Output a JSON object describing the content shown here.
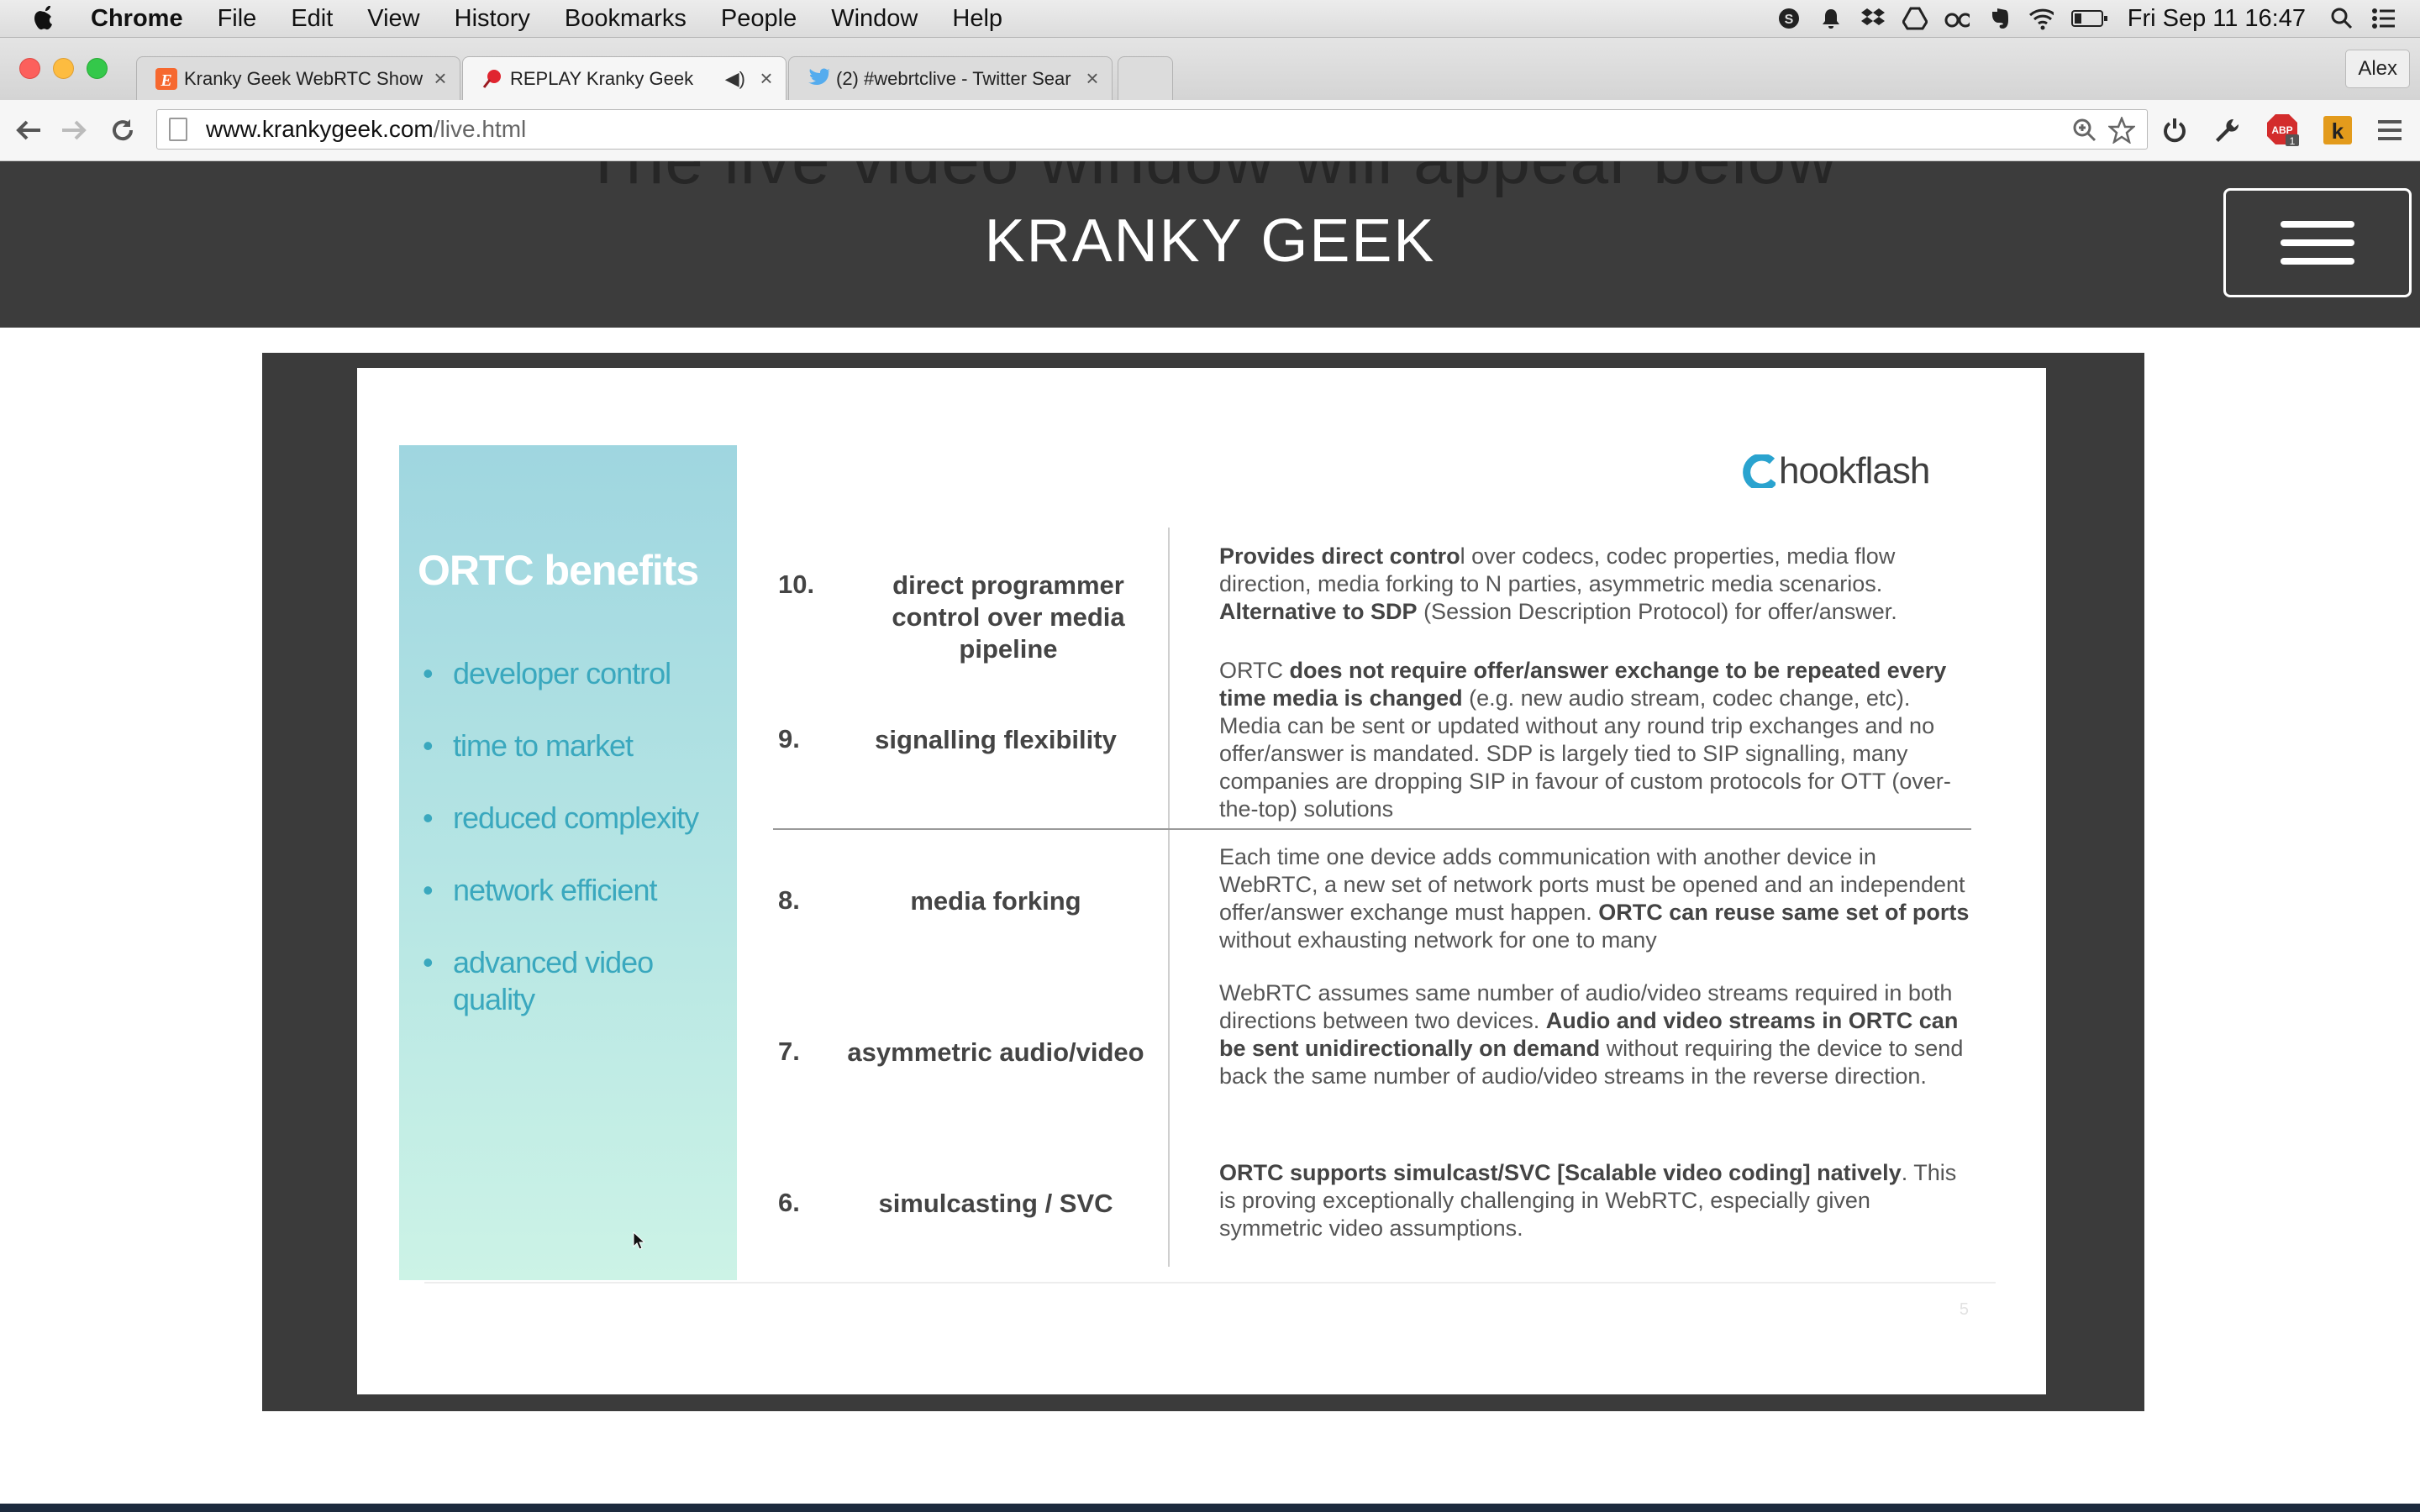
{
  "menubar": {
    "app": "Chrome",
    "items": [
      "File",
      "Edit",
      "View",
      "History",
      "Bookmarks",
      "People",
      "Window",
      "Help"
    ],
    "clock": "Fri Sep 11  16:47",
    "status_icons": [
      "skype-icon",
      "notification-icon",
      "dropbox-icon",
      "google-drive-icon",
      "glasses-icon",
      "evernote-icon",
      "wifi-icon",
      "battery-icon",
      "spotlight-icon",
      "notification-center-icon"
    ]
  },
  "browser": {
    "tabs": [
      {
        "title": "Kranky Geek WebRTC Show",
        "favicon": "E"
      },
      {
        "title": "REPLAY Kranky Geek",
        "favicon": "pin"
      },
      {
        "title": "(2) #webrtclive - Twitter Sear",
        "favicon": "twitter"
      }
    ],
    "close_glyph": "×",
    "audio_glyph": "◀)",
    "profile": "Alex",
    "url_host": "www.krankygeek.com",
    "url_path": "/live.html",
    "abp_badge": "1"
  },
  "site": {
    "ghost_text": "The live video window will appear below",
    "brand": "KRANKY GEEK"
  },
  "slide": {
    "panel_title": "ORTC benefits",
    "benefits": [
      "developer control",
      "time to market",
      "reduced complexity",
      "network efficient",
      "advanced video quality"
    ],
    "logo": "hookflash",
    "rows": [
      {
        "num": "10.",
        "name": "direct programmer control over media pipeline"
      },
      {
        "num": "9.",
        "name": "signalling flexibility"
      },
      {
        "num": "8.",
        "name": "media forking"
      },
      {
        "num": "7.",
        "name": "asymmetric audio/video"
      },
      {
        "num": "6.",
        "name": "simulcasting / SVC"
      }
    ],
    "desc10": {
      "b1": "Provides direct contro",
      "t1": "l over codecs, codec properties, media flow direction, media forking to N parties, asymmetric media scenarios. ",
      "b2": "Alternative to SDP",
      "t2": " (Session Description Protocol) for offer/answer."
    },
    "desc9": {
      "t1": "ORTC ",
      "b1": "does not require offer/answer exchange to be repeated every time media is changed",
      "t2": " (e.g. new audio stream, codec change, etc). Media can be sent or updated without any round trip exchanges and no offer/answer is mandated. SDP is largely tied to SIP signalling, many companies are dropping SIP in favour of custom protocols for OTT (over-the-top) solutions"
    },
    "desc8": {
      "t1": "Each time one device adds communication with another device in WebRTC, a new set of network ports must be opened and an independent offer/answer exchange must happen. ",
      "b1": "ORTC can reuse same set of ports",
      "t2": " without exhausting network for one to many"
    },
    "desc7": {
      "t1": "WebRTC assumes same number of audio/video streams required in both directions between two devices. ",
      "b1": "Audio and video streams in ORTC can be sent unidirectionally on demand",
      "t2": " without requiring the device to send back the same number of audio/video streams in the reverse direction."
    },
    "desc6": {
      "b1": "ORTC supports simulcast/SVC [Scalable video coding] natively",
      "t1": ". This is proving exceptionally challenging in WebRTC, especially given symmetric video assumptions."
    },
    "page_number": "5"
  }
}
